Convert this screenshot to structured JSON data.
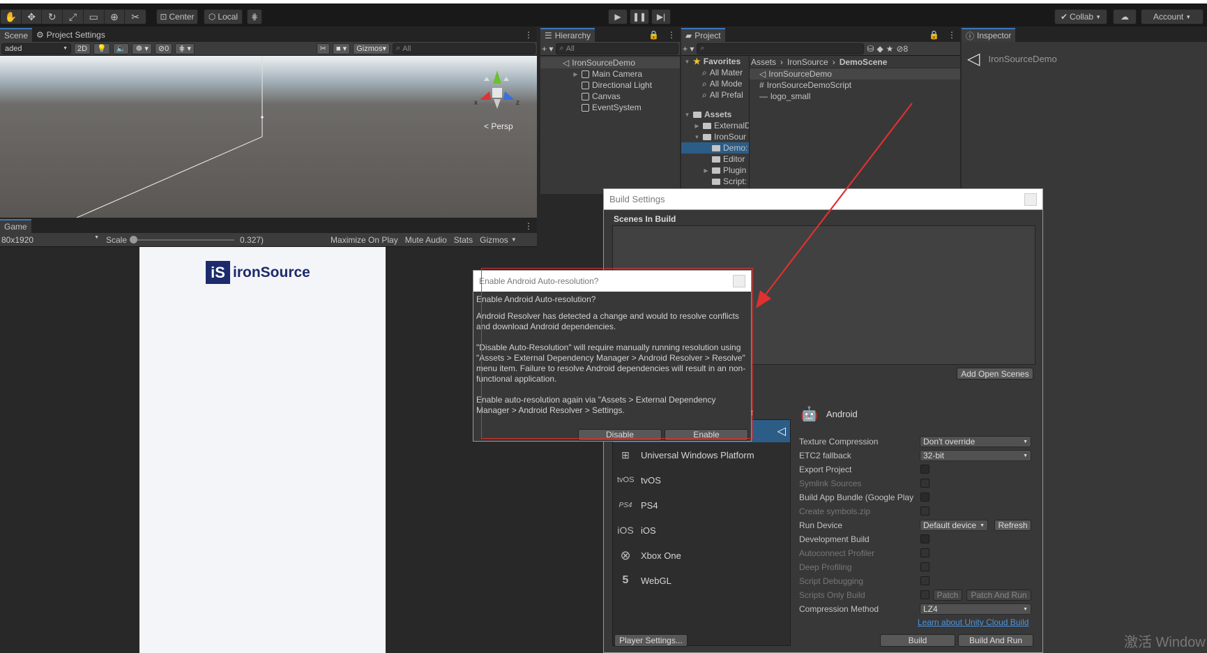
{
  "toolbar": {
    "pivot_label": "Center",
    "space_label": "Local",
    "collab_label": "Collab",
    "account_label": "Account"
  },
  "scene": {
    "tab_scene": "Scene",
    "tab_project_settings": "Project Settings",
    "shading_mode": "aded",
    "btn_2d": "2D",
    "hidden_count": "0",
    "gizmos_label": "Gizmos",
    "search_placeholder": "All",
    "persp_label": "< Persp",
    "axis_x": "x",
    "axis_z": "z"
  },
  "game": {
    "tab_game": "Game",
    "resolution": "80x1920",
    "scale_label": "Scale",
    "scale_value": "0.327)",
    "maximize_label": "Maximize On Play",
    "mute_label": "Mute Audio",
    "stats_label": "Stats",
    "gizmos_label": "Gizmos",
    "logo_text": "ironSource"
  },
  "hierarchy": {
    "tab": "Hierarchy",
    "search_placeholder": "All",
    "scene_name": "IronSourceDemo",
    "items": [
      "Main Camera",
      "Directional Light",
      "Canvas",
      "EventSystem"
    ]
  },
  "project": {
    "tab": "Project",
    "hidden_count": "8",
    "favorites_label": "Favorites",
    "favorites": [
      "All Mater",
      "All Mode",
      "All Prefal"
    ],
    "assets_label": "Assets",
    "tree": [
      "ExternalD",
      "IronSour",
      "Demo:",
      "Editor",
      "Plugin",
      "Script:"
    ],
    "breadcrumb": [
      "Assets",
      "IronSource",
      "DemoScene"
    ],
    "files": [
      "IronSourceDemo",
      "IronSourceDemoScript",
      "logo_small"
    ]
  },
  "inspector": {
    "tab": "Inspector",
    "object_name": "IronSourceDemo"
  },
  "build_settings": {
    "title": "Build Settings",
    "scenes_header": "Scenes In Build",
    "add_open_scenes": "Add Open Scenes",
    "platform_header_partial": "ne",
    "platforms": [
      {
        "icon": "windows-icon",
        "glyph": "⊞",
        "label": "Universal Windows Platform"
      },
      {
        "icon": "tvos-icon",
        "glyph": "tvOS",
        "label": "tvOS"
      },
      {
        "icon": "ps4-icon",
        "glyph": "PS4",
        "label": "PS4"
      },
      {
        "icon": "ios-icon",
        "glyph": "iOS",
        "label": "iOS"
      },
      {
        "icon": "xbox-icon",
        "glyph": "⊗",
        "label": "Xbox One"
      },
      {
        "icon": "html5-icon",
        "glyph": "5",
        "label": "WebGL"
      }
    ],
    "selected_platform": "Android",
    "texture_compression_label": "Texture Compression",
    "texture_compression_value": "Don't override",
    "etc2_label": "ETC2 fallback",
    "etc2_value": "32-bit",
    "export_project_label": "Export Project",
    "symlink_label": "Symlink Sources",
    "app_bundle_label": "Build App Bundle (Google Play",
    "symbols_label": "Create symbols.zip",
    "run_device_label": "Run Device",
    "run_device_value": "Default device",
    "refresh_label": "Refresh",
    "dev_build_label": "Development Build",
    "autoconnect_label": "Autoconnect Profiler",
    "deep_profiling_label": "Deep Profiling",
    "script_debugging_label": "Script Debugging",
    "scripts_only_label": "Scripts Only Build",
    "patch_label": "Patch",
    "patch_run_label": "Patch And Run",
    "compression_label": "Compression Method",
    "compression_value": "LZ4",
    "cloud_build_link": "Learn about Unity Cloud Build",
    "player_settings": "Player Settings...",
    "build": "Build",
    "build_and_run": "Build And Run"
  },
  "dialog": {
    "title": "Enable Android Auto-resolution?",
    "heading": "Enable Android Auto-resolution?",
    "para1": "Android Resolver has detected a change  and would to resolve conflicts and download Android dependencies.",
    "para2": "\"Disable Auto-Resolution\" will require manually running resolution using \"Assets > External Dependency Manager > Android Resolver > Resolve\" menu item. Failure to resolve Android dependencies will result in an non-functional application.",
    "para3": "Enable auto-resolution again via \"Assets > External Dependency Manager > Android Resolver > Settings.",
    "disable": "Disable",
    "enable": "Enable"
  },
  "watermark": "激活 Window",
  "colors": {
    "accent": "#3a79bb",
    "annotation": "#e03030",
    "logo": "#1d2a6b"
  }
}
